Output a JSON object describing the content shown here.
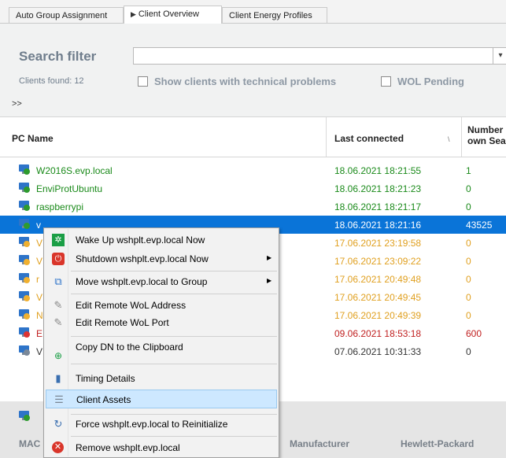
{
  "tabs": [
    {
      "label": "Auto Group Assignment"
    },
    {
      "label": "Client Overview",
      "active": true
    },
    {
      "label": "Client Energy Profiles"
    }
  ],
  "filter": {
    "title": "Search filter",
    "clients_found": "Clients found: 12",
    "show_problems": "Show clients with technical problems",
    "wol_pending": "WOL Pending",
    "expander": ">>"
  },
  "table": {
    "headers": {
      "pc_name": "PC Name",
      "last_connected": "Last connected",
      "seats": "Number own Sea"
    },
    "rows": [
      {
        "name": "W2016S.evp.local",
        "last": "18.06.2021 18:21:55",
        "seats": "1",
        "status": "online"
      },
      {
        "name": "EnviProtUbuntu",
        "last": "18.06.2021 18:21:23",
        "seats": "0",
        "status": "online"
      },
      {
        "name": "raspberrypi",
        "last": "18.06.2021 18:21:17",
        "seats": "0",
        "status": "online"
      },
      {
        "name": "v",
        "last": "18.06.2021 18:21:16",
        "seats": "43525",
        "status": "selected"
      },
      {
        "name": "V",
        "last": "17.06.2021 23:19:58",
        "seats": "0",
        "status": "stale"
      },
      {
        "name": "V",
        "last": "17.06.2021 23:09:22",
        "seats": "0",
        "status": "stale"
      },
      {
        "name": "r",
        "last": "17.06.2021 20:49:48",
        "seats": "0",
        "status": "stale"
      },
      {
        "name": "V",
        "last": "17.06.2021 20:49:45",
        "seats": "0",
        "status": "stale"
      },
      {
        "name": "N",
        "last": "17.06.2021 20:49:39",
        "seats": "0",
        "status": "stale"
      },
      {
        "name": "E",
        "last": "09.06.2021 18:53:18",
        "seats": "600",
        "status": "error"
      },
      {
        "name": "V",
        "last": "07.06.2021 10:31:33",
        "seats": "0",
        "status": "old"
      }
    ]
  },
  "bottom": {
    "mac_label": "MAC",
    "manufacturer_label": "Manufacturer",
    "manufacturer_value": "Hewlett-Packard"
  },
  "context_menu": {
    "items": [
      {
        "label": "Wake Up wshplt.evp.local Now",
        "icon": "wake-up-icon"
      },
      {
        "label": "Shutdown wshplt.evp.local Now",
        "icon": "shutdown-icon",
        "submenu": true
      },
      {
        "label": "Move wshplt.evp.local to Group",
        "icon": "move-group-icon",
        "submenu": true
      },
      {
        "label": "Edit Remote WoL Address",
        "icon": "edit-icon"
      },
      {
        "label": "Edit Remote WoL Port",
        "icon": "edit-icon"
      },
      {
        "label": "Copy DN to the Clipboard",
        "icon": "copy-dn-icon"
      },
      {
        "label": "Timing Details",
        "icon": "timing-chart-icon"
      },
      {
        "label": "Client Assets",
        "icon": "assets-database-icon",
        "highlighted": true
      },
      {
        "label": "Force wshplt.evp.local to Reinitialize",
        "icon": "reinitialize-icon"
      },
      {
        "label": "Remove wshplt.evp.local",
        "icon": "remove-icon"
      }
    ]
  },
  "colors": {
    "online": "#1a8a1a",
    "stale": "#e0a020",
    "error": "#c02020",
    "old": "#333333",
    "selected_bg": "#0a74d8",
    "menu_highlight": "#cde8ff"
  }
}
